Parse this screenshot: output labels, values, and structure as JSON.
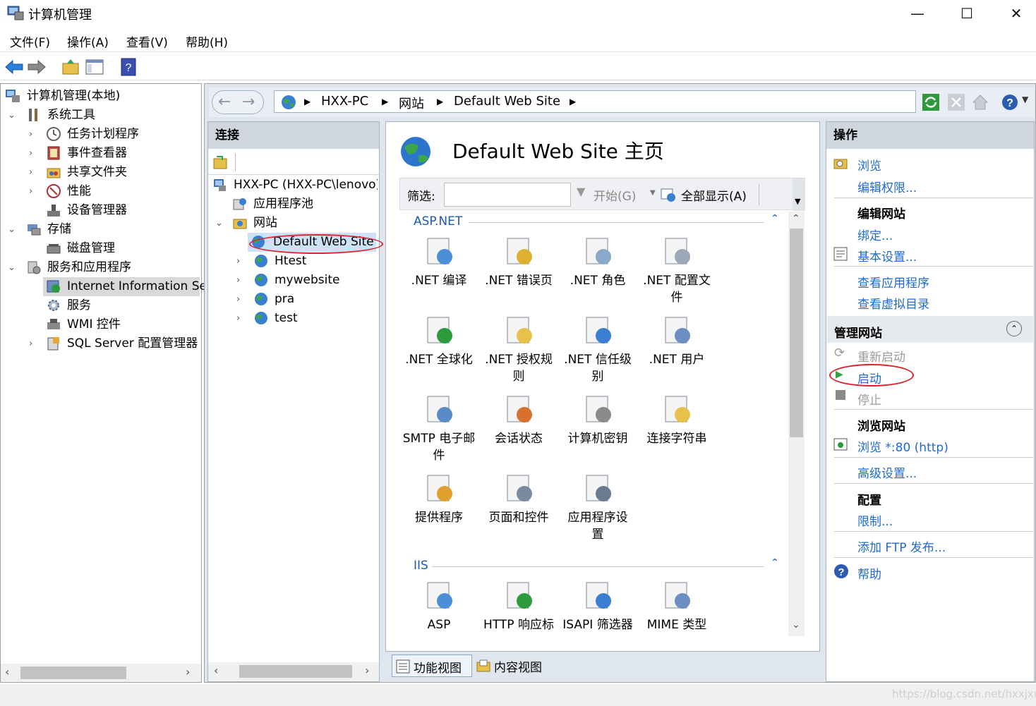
{
  "window": {
    "title": "计算机管理",
    "minimize": "—",
    "maximize": "☐",
    "close": "✕"
  },
  "menu": [
    "文件(F)",
    "操作(A)",
    "查看(V)",
    "帮助(H)"
  ],
  "tree": {
    "root": "计算机管理(本地)",
    "items": [
      {
        "label": "系统工具"
      },
      {
        "label": "任务计划程序"
      },
      {
        "label": "事件查看器"
      },
      {
        "label": "共享文件夹"
      },
      {
        "label": "性能"
      },
      {
        "label": "设备管理器"
      },
      {
        "label": "存储"
      },
      {
        "label": "磁盘管理"
      },
      {
        "label": "服务和应用程序"
      },
      {
        "label": "Internet Information Se"
      },
      {
        "label": "服务"
      },
      {
        "label": "WMI 控件"
      },
      {
        "label": "SQL Server 配置管理器"
      }
    ]
  },
  "address": {
    "crumbs": [
      "HXX-PC",
      "网站",
      "Default Web Site"
    ]
  },
  "connections": {
    "header": "连接",
    "server": "HXX-PC (HXX-PC\\lenovo)",
    "app_pools": "应用程序池",
    "sites": "网站",
    "site_list": [
      "Default Web Site",
      "Htest",
      "mywebsite",
      "pra",
      "test"
    ]
  },
  "center": {
    "title": "Default Web Site 主页",
    "filter_label": "筛选:",
    "filter_value": "",
    "start_btn": "开始(G)",
    "showall_btn": "全部显示(A)",
    "group_aspnet": "ASP.NET",
    "group_iis": "IIS",
    "aspnet_features": [
      [
        ".NET 编译",
        ""
      ],
      [
        ".NET 错误页",
        ""
      ],
      [
        ".NET 角色",
        ""
      ],
      [
        ".NET 配置文",
        "件"
      ],
      [
        ".NET 全球化",
        ""
      ],
      [
        ".NET 授权规",
        "则"
      ],
      [
        ".NET 信任级",
        "别"
      ],
      [
        ".NET 用户",
        ""
      ],
      [
        "SMTP 电子邮",
        "件"
      ],
      [
        "会话状态",
        ""
      ],
      [
        "计算机密钥",
        ""
      ],
      [
        "连接字符串",
        ""
      ],
      [
        "提供程序",
        ""
      ],
      [
        "页面和控件",
        ""
      ],
      [
        "应用程序设",
        "置"
      ]
    ],
    "iis_features": [
      "ASP",
      "HTTP 响应标",
      "ISAPI 筛选器",
      "MIME 类型"
    ],
    "tab_feature": "功能视图",
    "tab_content": "内容视图"
  },
  "actions": {
    "header": "操作",
    "browse": "浏览",
    "edit_perm": "编辑权限...",
    "edit_site": "编辑网站",
    "bindings": "绑定...",
    "basic": "基本设置...",
    "view_apps": "查看应用程序",
    "view_vdirs": "查看虚拟目录",
    "manage_site": "管理网站",
    "restart": "重新启动",
    "start": "启动",
    "stop": "停止",
    "browse_site": "浏览网站",
    "browse_80": "浏览 *:80 (http)",
    "advanced": "高级设置...",
    "config": "配置",
    "limits": "限制...",
    "add_ftp": "添加 FTP 发布...",
    "help": "帮助"
  },
  "watermark": "https://blog.csdn.net/hxxjxw"
}
